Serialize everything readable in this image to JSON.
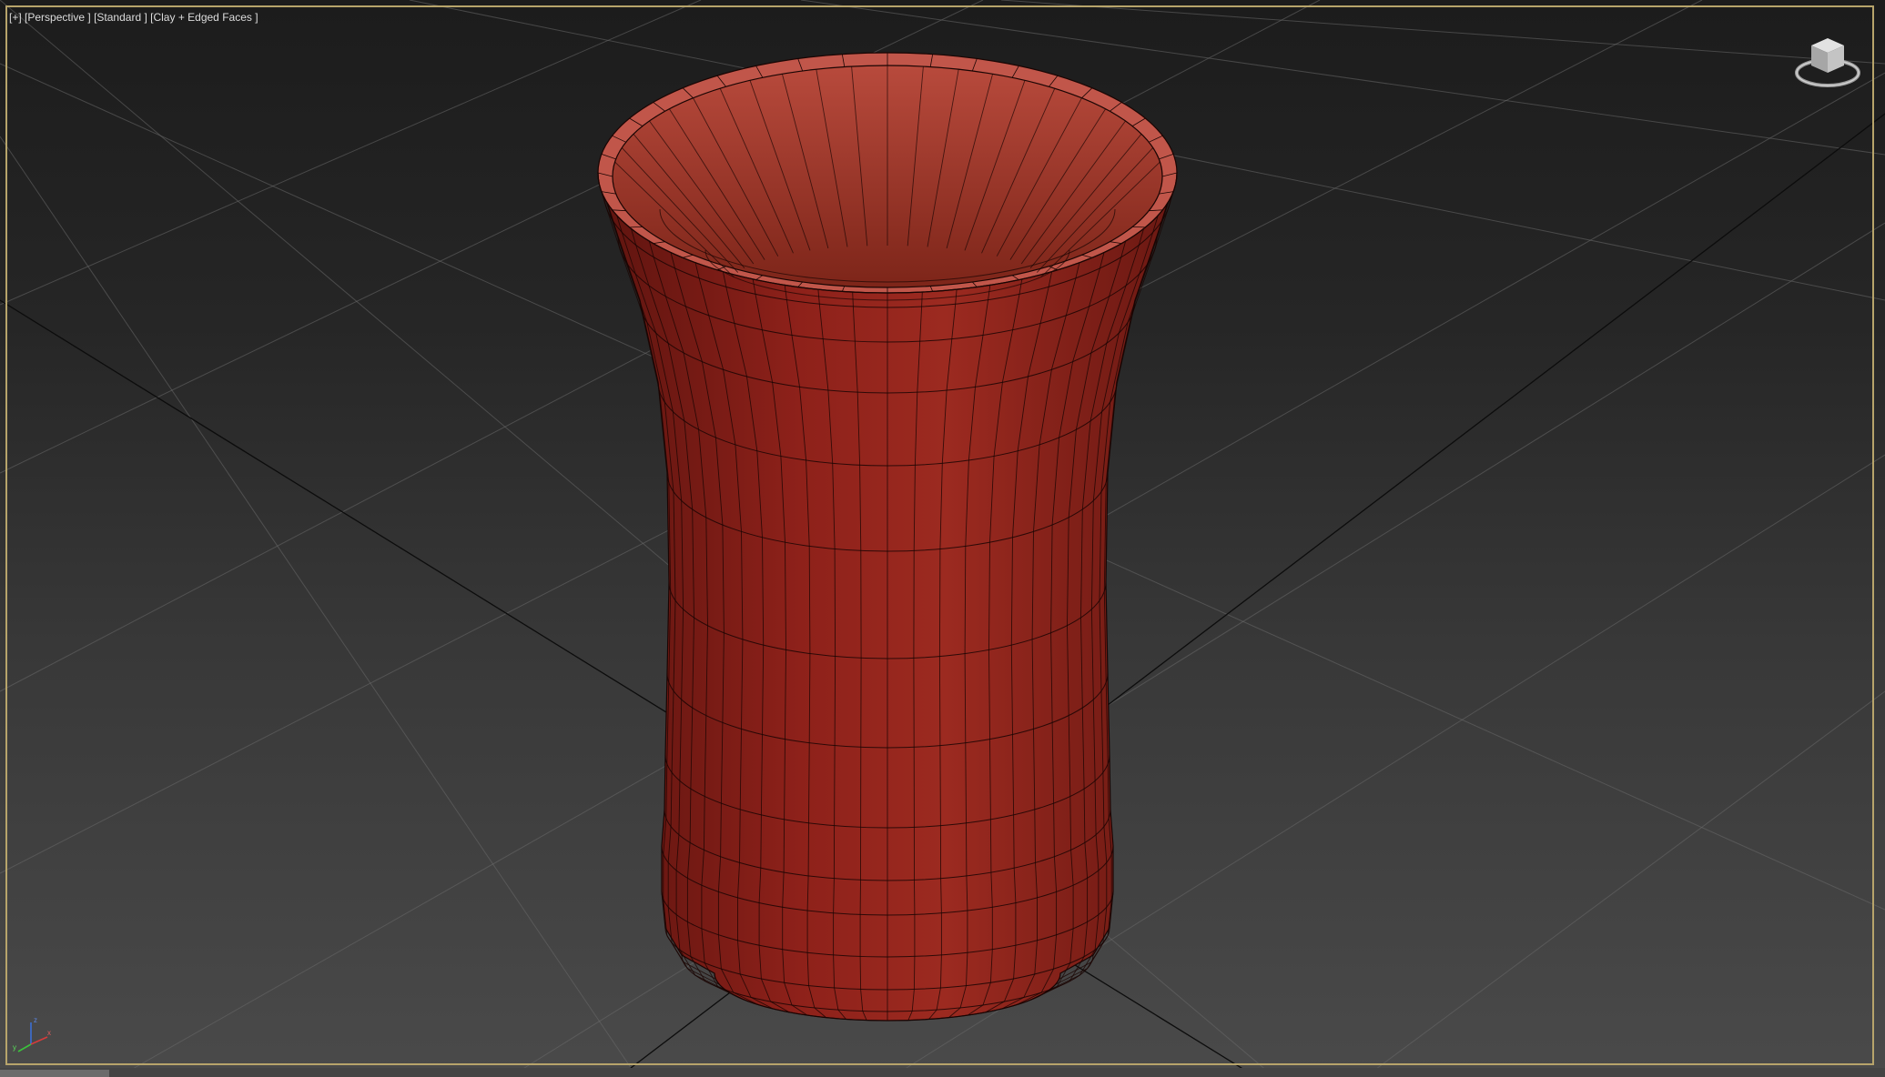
{
  "viewport": {
    "labels": [
      "[+]",
      "[Perspective ]",
      "[Standard ]",
      "[Clay + Edged Faces ]"
    ],
    "border_color": "#b7a46b",
    "mesh_color": "#8e211a",
    "grid_color": "#6a6a6a"
  },
  "icons": {
    "viewcube": "viewcube-icon",
    "axis_tripod": "axis-tripod-icon"
  }
}
